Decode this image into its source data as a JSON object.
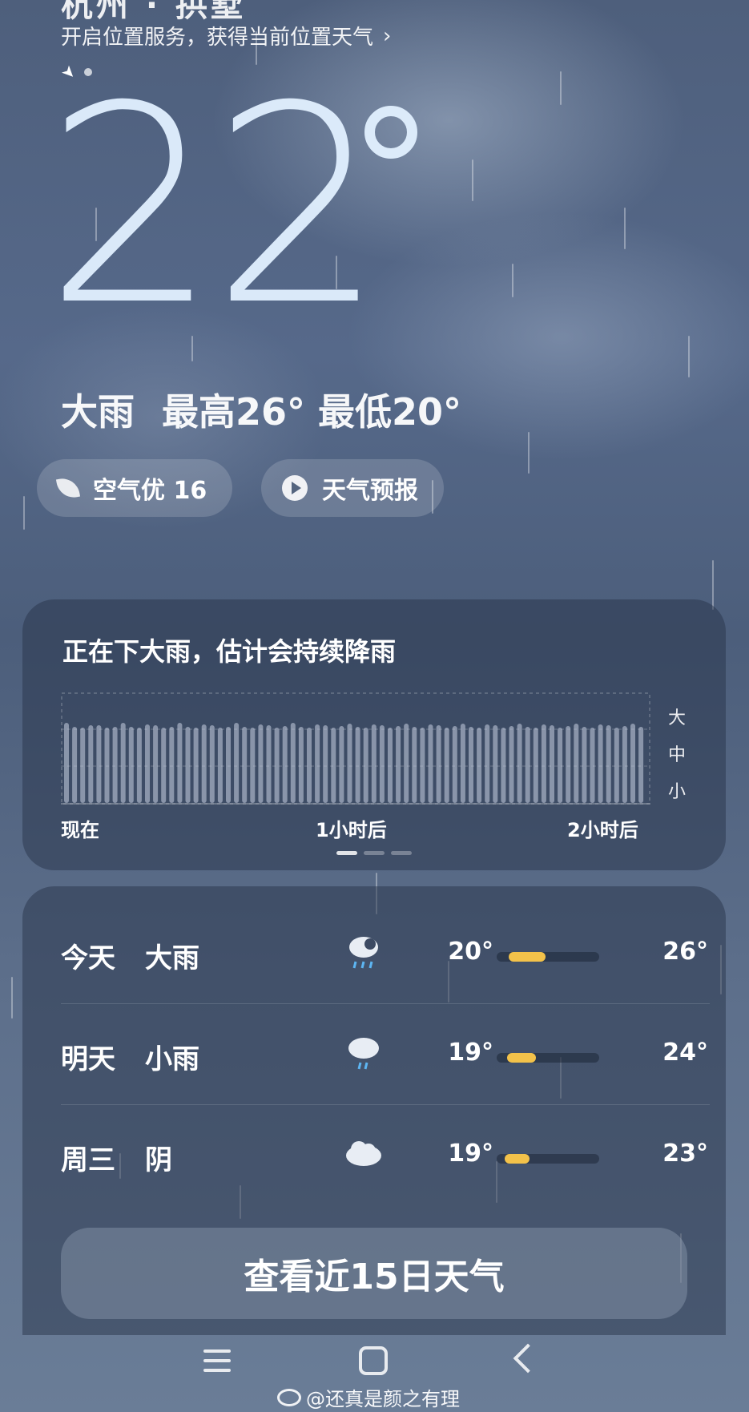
{
  "header": {
    "city_cut": "杭州 · 拱墅",
    "location_hint": "开启位置服务，获得当前位置天气",
    "location_chevron": "›"
  },
  "current": {
    "temperature": "22",
    "condition": "大雨",
    "high": "最高26°",
    "low": "最低20°"
  },
  "chips": {
    "aqi_label": "空气优 16",
    "forecast_label": "天气预报"
  },
  "precipitation": {
    "title": "正在下大雨，估计会持续降雨",
    "intensity_labels": [
      "大",
      "中",
      "小"
    ],
    "time_labels": [
      "现在",
      "1小时后",
      "2小时后"
    ],
    "level": "heavy"
  },
  "daily": [
    {
      "day": "今天",
      "cond": "大雨",
      "icon": "heavy-rain-icon",
      "lo": "20°",
      "hi": "26°",
      "bar_start": 0.12,
      "bar_end": 0.48
    },
    {
      "day": "明天",
      "cond": "小雨",
      "icon": "light-rain-icon",
      "lo": "19°",
      "hi": "24°",
      "bar_start": 0.1,
      "bar_end": 0.38
    },
    {
      "day": "周三",
      "cond": "阴",
      "icon": "cloudy-icon",
      "lo": "19°",
      "hi": "23°",
      "bar_start": 0.08,
      "bar_end": 0.32
    }
  ],
  "more_button": "查看近15日天气",
  "watermark": "@还真是颜之有理",
  "colors": {
    "bar_fill": "#f3c24a",
    "card_bg": "#28344a"
  }
}
